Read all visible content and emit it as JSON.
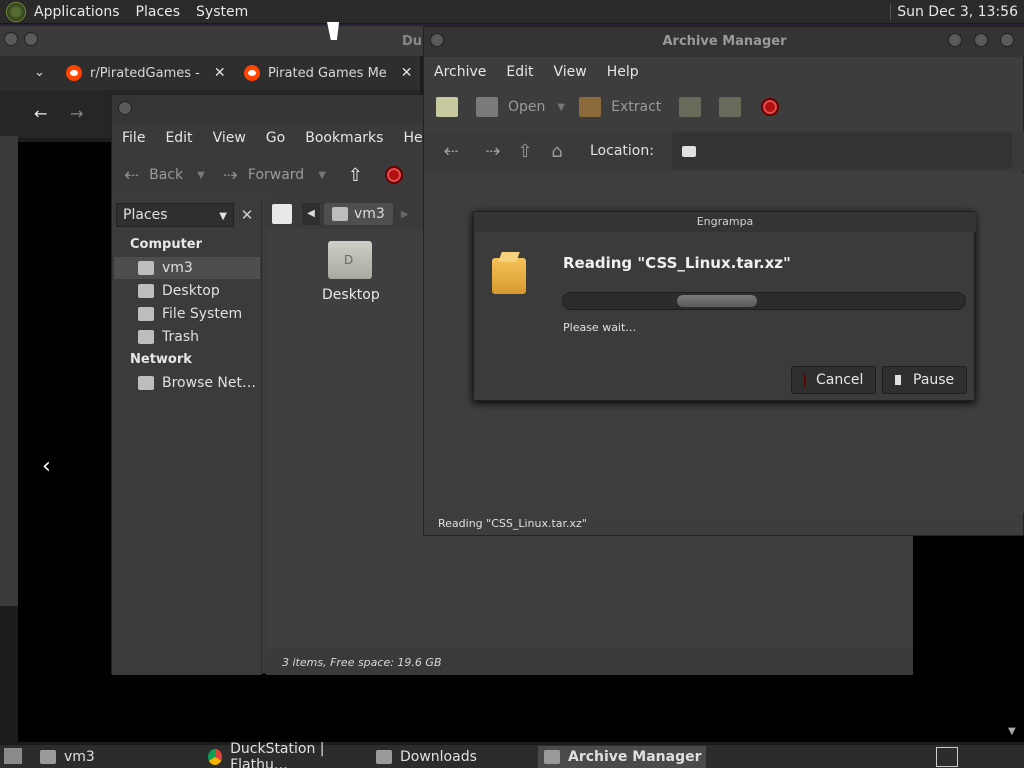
{
  "top_panel": {
    "menus": [
      "Applications",
      "Places",
      "System"
    ],
    "clock": "Sun Dec 3, 13:56"
  },
  "browser": {
    "title_partial": "Du",
    "tabs": [
      {
        "label": "r/PiratedGames -",
        "close": "✕"
      },
      {
        "label": "Pirated Games Me",
        "close": "✕"
      }
    ],
    "tab_dropdown": "⌄",
    "back": "←",
    "forward": "→",
    "content_back": "‹"
  },
  "caja": {
    "menus": [
      "File",
      "Edit",
      "View",
      "Go",
      "Bookmarks",
      "Help"
    ],
    "toolbar": {
      "back": "Back",
      "forward": "Forward"
    },
    "sidebar": {
      "selector": "Places",
      "close": "✕",
      "sections": [
        {
          "heading": "Computer",
          "items": [
            "vm3",
            "Desktop",
            "File System",
            "Trash"
          ]
        },
        {
          "heading": "Network",
          "items": [
            "Browse Net…"
          ]
        }
      ]
    },
    "path": {
      "current": "vm3"
    },
    "items": [
      {
        "label": "Desktop"
      }
    ],
    "status": "3 items, Free space: 19.6 GB"
  },
  "archive": {
    "title": "Archive Manager",
    "menus": [
      "Archive",
      "Edit",
      "View",
      "Help"
    ],
    "toolbar": {
      "open": "Open",
      "extract": "Extract"
    },
    "location_label": "Location:",
    "status": "Reading \"CSS_Linux.tar.xz\""
  },
  "dialog": {
    "title": "Engrampa",
    "heading": "Reading \"CSS_Linux.tar.xz\"",
    "message": "Please wait…",
    "cancel": "Cancel",
    "pause": "Pause"
  },
  "taskbar": {
    "items": [
      {
        "label": "vm3",
        "active": false
      },
      {
        "label": "DuckStation | Flathu…",
        "active": false
      },
      {
        "label": "Downloads",
        "active": false
      },
      {
        "label": "Archive Manager",
        "active": true
      }
    ]
  }
}
